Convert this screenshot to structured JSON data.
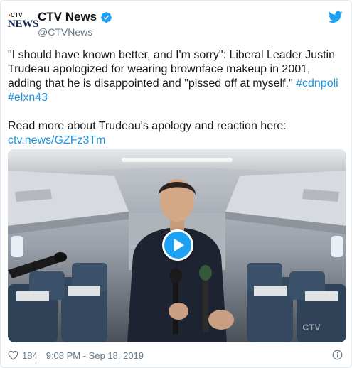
{
  "account": {
    "logo_top": "CTV",
    "logo_word": "NEWS",
    "display_name": "CTV News",
    "handle": "@CTVNews",
    "verified": true
  },
  "tweet": {
    "text_main": "\"I should have known better, and I'm sorry\":  Liberal Leader Justin Trudeau apologized for wearing brownface makeup in 2001, adding that he is disappointed and \"pissed off at myself.\" ",
    "hashtag_1": "#cdnpoli",
    "hashtag_2": "#elxn43",
    "read_more": "Read more about Trudeau's apology and reaction here:",
    "link": "ctv.news/GZFz3Tm"
  },
  "media": {
    "type": "video",
    "watermark": "CTV"
  },
  "footer": {
    "like_count": "184",
    "timestamp": "9:08 PM - Sep 18, 2019"
  },
  "colors": {
    "link": "#1b95e0",
    "play_button": "#1da1f2",
    "verified_badge": "#1da1f2",
    "muted_text": "#657786"
  },
  "icons": [
    "verified-badge-icon",
    "twitter-bird-icon",
    "play-icon",
    "heart-icon",
    "info-icon"
  ]
}
